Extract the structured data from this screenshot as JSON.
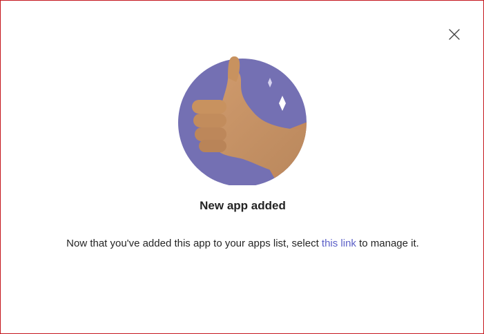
{
  "dialog": {
    "close_icon": "close-icon",
    "illustration_icon": "thumbs-up-icon",
    "title": "New app added",
    "message_before": "Now that you've added this app to your apps list, select ",
    "link_text": "this link",
    "message_after": " to manage it."
  },
  "colors": {
    "border": "#c4151c",
    "circle": "#7470b3",
    "link": "#5b5fc7",
    "text": "#242424"
  }
}
